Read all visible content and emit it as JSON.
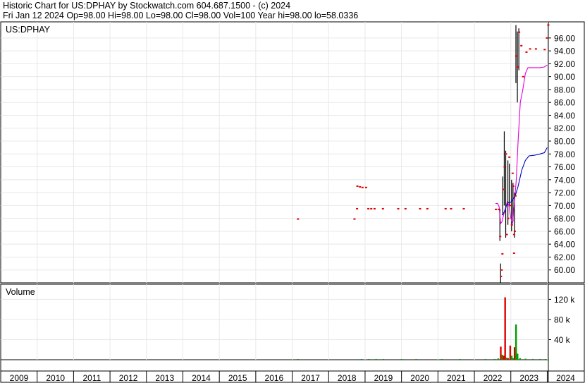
{
  "header": {
    "line1": "Historic Chart for US:DPHAY by Stockwatch.com 604.687.1500 - (c) 2024",
    "line2": "Fri Jan 12 2024   Op=98.00   Hi=98.00   Lo=98.00   Cl=98.00   Vol=100   Year hi=98.00   lo=58.0336"
  },
  "chart_data": [
    {
      "type": "line",
      "title": "US:DPHAY",
      "y_ticks": [
        "60.00",
        "62.00",
        "64.00",
        "66.00",
        "68.00",
        "70.00",
        "72.00",
        "74.00",
        "76.00",
        "78.00",
        "80.00",
        "82.00",
        "84.00",
        "86.00",
        "88.00",
        "90.00",
        "92.00",
        "94.00",
        "96.00"
      ],
      "ylim": [
        58.0,
        98.5
      ],
      "x_ticks": [
        "2009",
        "2010",
        "2011",
        "2012",
        "2013",
        "2014",
        "2015",
        "2016",
        "2017",
        "2018",
        "2019",
        "2020",
        "2021",
        "2022",
        "2023",
        "2024"
      ],
      "xlim": [
        2009.0,
        2024.03
      ],
      "grid": true,
      "colors": {
        "price_bar": "#000000",
        "close_dot": "#e00000",
        "short_ma": "#e000e0",
        "long_ma": "#0000c0"
      },
      "close_points": [
        [
          2017.15,
          67.9
        ],
        [
          2018.7,
          67.9
        ],
        [
          2018.78,
          73.0
        ],
        [
          2018.85,
          72.9
        ],
        [
          2018.92,
          72.8
        ],
        [
          2019.02,
          72.8
        ],
        [
          2018.77,
          69.5
        ],
        [
          2019.08,
          69.5
        ],
        [
          2019.16,
          69.5
        ],
        [
          2019.25,
          69.5
        ],
        [
          2019.48,
          69.5
        ],
        [
          2019.9,
          69.5
        ],
        [
          2020.1,
          69.5
        ],
        [
          2020.5,
          69.5
        ],
        [
          2020.7,
          69.5
        ],
        [
          2021.2,
          69.5
        ],
        [
          2021.35,
          69.5
        ],
        [
          2021.7,
          69.5
        ],
        [
          2022.58,
          69.4
        ],
        [
          2022.66,
          69.4
        ],
        [
          2022.7,
          65.2
        ],
        [
          2022.72,
          59.0
        ],
        [
          2022.74,
          60.0
        ],
        [
          2022.76,
          62.5
        ],
        [
          2022.78,
          72.5
        ],
        [
          2022.82,
          76.0
        ],
        [
          2022.86,
          78.0
        ],
        [
          2022.88,
          65.5
        ],
        [
          2022.92,
          68.0
        ],
        [
          2022.95,
          77.5
        ],
        [
          2022.98,
          70.0
        ],
        [
          2023.02,
          67.0
        ],
        [
          2023.04,
          75.0
        ],
        [
          2023.06,
          73.0
        ],
        [
          2023.08,
          65.5
        ],
        [
          2023.08,
          62.6
        ],
        [
          2023.1,
          66.0
        ],
        [
          2023.12,
          71.5
        ],
        [
          2023.14,
          93.2
        ],
        [
          2023.18,
          91.5
        ],
        [
          2023.22,
          96.9
        ],
        [
          2023.28,
          94.8
        ],
        [
          2023.33,
          90.0
        ],
        [
          2023.42,
          93.8
        ],
        [
          2023.52,
          94.3
        ],
        [
          2023.68,
          94.3
        ],
        [
          2023.92,
          94.2
        ],
        [
          2023.98,
          96.0
        ],
        [
          2024.02,
          98.0
        ]
      ],
      "price_bars": [
        [
          2022.7,
          64.5,
          69.5
        ],
        [
          2022.72,
          58.0,
          61.0
        ],
        [
          2022.78,
          68.5,
          74.5
        ],
        [
          2022.82,
          70.0,
          81.5
        ],
        [
          2022.86,
          65.0,
          78.5
        ],
        [
          2022.92,
          67.0,
          77.0
        ],
        [
          2022.96,
          70.0,
          76.5
        ],
        [
          2023.02,
          66.0,
          74.0
        ],
        [
          2023.06,
          67.5,
          73.5
        ],
        [
          2023.1,
          65.0,
          72.0
        ],
        [
          2023.14,
          89.0,
          98.0
        ],
        [
          2023.18,
          86.0,
          97.0
        ],
        [
          2023.22,
          91.0,
          97.5
        ]
      ],
      "short_ma": [
        [
          2022.58,
          70.3
        ],
        [
          2022.64,
          70.3
        ],
        [
          2022.68,
          69.8
        ],
        [
          2022.72,
          67.2
        ],
        [
          2022.76,
          67.5
        ],
        [
          2022.8,
          68.5
        ],
        [
          2022.86,
          69.5
        ],
        [
          2022.9,
          70.5
        ],
        [
          2022.95,
          70.0
        ],
        [
          2023.0,
          68.0
        ],
        [
          2023.05,
          67.2
        ],
        [
          2023.1,
          70.5
        ],
        [
          2023.15,
          74.0
        ],
        [
          2023.2,
          80.0
        ],
        [
          2023.26,
          86.0
        ],
        [
          2023.33,
          88.0
        ],
        [
          2023.4,
          90.5
        ],
        [
          2023.47,
          91.4
        ],
        [
          2023.6,
          91.4
        ],
        [
          2023.8,
          91.4
        ],
        [
          2023.92,
          91.5
        ],
        [
          2024.0,
          91.8
        ]
      ],
      "long_ma": [
        [
          2022.76,
          68.5
        ],
        [
          2022.82,
          69.0
        ],
        [
          2022.88,
          70.0
        ],
        [
          2022.94,
          70.5
        ],
        [
          2023.0,
          70.5
        ],
        [
          2023.06,
          71.0
        ],
        [
          2023.12,
          71.5
        ],
        [
          2023.2,
          73.0
        ],
        [
          2023.3,
          75.5
        ],
        [
          2023.4,
          77.0
        ],
        [
          2023.5,
          77.7
        ],
        [
          2023.65,
          77.8
        ],
        [
          2023.8,
          78.0
        ],
        [
          2023.92,
          78.2
        ],
        [
          2024.0,
          79.0
        ]
      ]
    },
    {
      "type": "bar",
      "title": "Volume",
      "y_ticks": [
        "40 k",
        "80 k",
        "120 k"
      ],
      "ylim": [
        0,
        150000
      ],
      "grid": true,
      "colors": {
        "up": "#00a000",
        "down": "#e00000"
      },
      "bars": [
        [
          2017.15,
          700,
          "up"
        ],
        [
          2018.9,
          800,
          "up"
        ],
        [
          2019.1,
          1000,
          "up"
        ],
        [
          2019.3,
          1500,
          "up"
        ],
        [
          2019.5,
          500,
          "up"
        ],
        [
          2020.0,
          600,
          "up"
        ],
        [
          2020.4,
          500,
          "up"
        ],
        [
          2021.1,
          700,
          "up"
        ],
        [
          2021.6,
          600,
          "up"
        ],
        [
          2022.3,
          800,
          "up"
        ],
        [
          2022.55,
          1500,
          "up"
        ],
        [
          2022.65,
          2500,
          "up"
        ],
        [
          2022.72,
          26000,
          "down"
        ],
        [
          2022.76,
          10000,
          "up"
        ],
        [
          2022.8,
          8000,
          "down"
        ],
        [
          2022.84,
          124000,
          "down"
        ],
        [
          2022.88,
          4000,
          "up"
        ],
        [
          2022.92,
          3000,
          "down"
        ],
        [
          2022.98,
          28000,
          "down"
        ],
        [
          2023.02,
          8000,
          "up"
        ],
        [
          2023.06,
          3000,
          "up"
        ],
        [
          2023.1,
          25000,
          "down"
        ],
        [
          2023.14,
          70000,
          "up"
        ],
        [
          2023.18,
          12000,
          "up"
        ],
        [
          2023.25,
          3000,
          "up"
        ],
        [
          2023.4,
          2000,
          "up"
        ],
        [
          2023.6,
          1500,
          "up"
        ],
        [
          2023.8,
          1000,
          "up"
        ],
        [
          2023.95,
          800,
          "up"
        ]
      ]
    }
  ]
}
